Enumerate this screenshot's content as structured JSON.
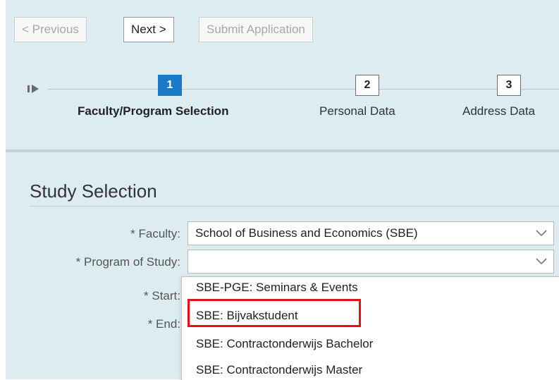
{
  "toolbar": {
    "previous_label": "Previous",
    "next_label": "Next",
    "submit_label": "Submit Application"
  },
  "roadmap": {
    "steps": [
      {
        "number": "1",
        "label": "Faculty/Program Selection",
        "state": "current"
      },
      {
        "number": "2",
        "label": "Personal Data",
        "state": "upcoming"
      },
      {
        "number": "3",
        "label": "Address Data",
        "state": "upcoming"
      }
    ]
  },
  "form": {
    "section_title": "Study Selection",
    "faculty_label": "* Faculty:",
    "faculty_value": "School of Business and Economics (SBE)",
    "program_label": "* Program of Study:",
    "program_value": "",
    "start_label": "* Start:",
    "end_label": "* End:"
  },
  "dropdown": {
    "options": [
      "SBE-PGE: Seminars & Events",
      "SBE: Bijvakstudent",
      "SBE: Contractonderwijs Bachelor",
      "SBE: Contractonderwijs Master"
    ],
    "highlighted_index": 1
  },
  "colors": {
    "background": "#dcecf0",
    "step_active": "#1a7ac8",
    "highlight": "#e3101a"
  }
}
